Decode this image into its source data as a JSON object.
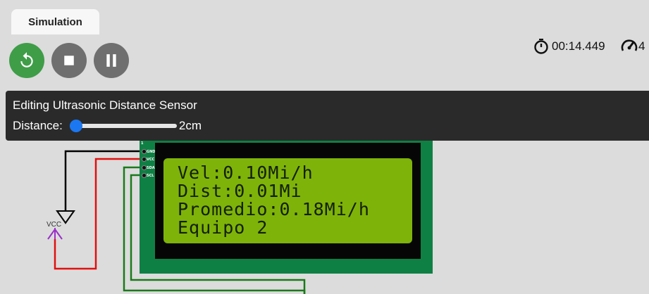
{
  "simulation": {
    "tab_label": "Simulation",
    "timer": "00:14.449",
    "speed_partial": "4",
    "controls": {
      "restart_icon": "restart-icon",
      "stop_icon": "stop-icon",
      "pause_icon": "pause-icon",
      "restart_color": "#3f9d48",
      "button_color": "#6f6f6f"
    }
  },
  "editor": {
    "title": "Editing Ultrasonic Distance Sensor",
    "distance_label": "Distance:",
    "distance_value": "2cm",
    "slider_fraction": 0.0,
    "accent": "#1b78f2"
  },
  "lcd": {
    "lines": [
      "Vel:0.10Mi/h",
      "Dist:0.01Mi",
      "Promedio:0.18Mi/h",
      "Equipo 2"
    ],
    "pins": [
      "GND",
      "VCC",
      "SDA",
      "SCL"
    ],
    "pin_header": "1",
    "board_color": "#0f8044",
    "screen_color": "#7eb30a"
  },
  "circuit": {
    "vcc_label": "VCC",
    "wire_colors": {
      "gnd": "#000000",
      "vcc": "#e01010",
      "signal": "#1a7a1a",
      "vcc_symbol": "#9b30c8"
    }
  }
}
